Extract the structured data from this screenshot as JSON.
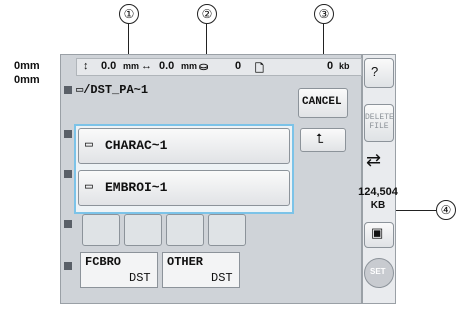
{
  "callouts": [
    "①",
    "②",
    "③",
    "④"
  ],
  "units": {
    "top": "0mm",
    "bottom": "0mm"
  },
  "stitch_info": {
    "h_value": "0.0",
    "h_unit": "mm",
    "w_value": "0.0",
    "w_unit": "mm",
    "thread_count": "0",
    "size": "0",
    "size_unit": "kb"
  },
  "path": "/DST_PA~1",
  "cancel_label": "CANCEL",
  "delete_label": [
    "DELETE",
    "FILE"
  ],
  "folders": [
    "CHARAC~1",
    "EMBROI~1"
  ],
  "files": [
    {
      "name": "FCBRO",
      "ext": "DST"
    },
    {
      "name": "OTHER",
      "ext": "DST"
    }
  ],
  "capacity": {
    "value": "124,504",
    "unit": "KB"
  },
  "set_label": "SET",
  "icons": [
    "help-icon",
    "up-folder-icon",
    "usb-icon",
    "embroidery-card-icon",
    "folder-icon"
  ]
}
